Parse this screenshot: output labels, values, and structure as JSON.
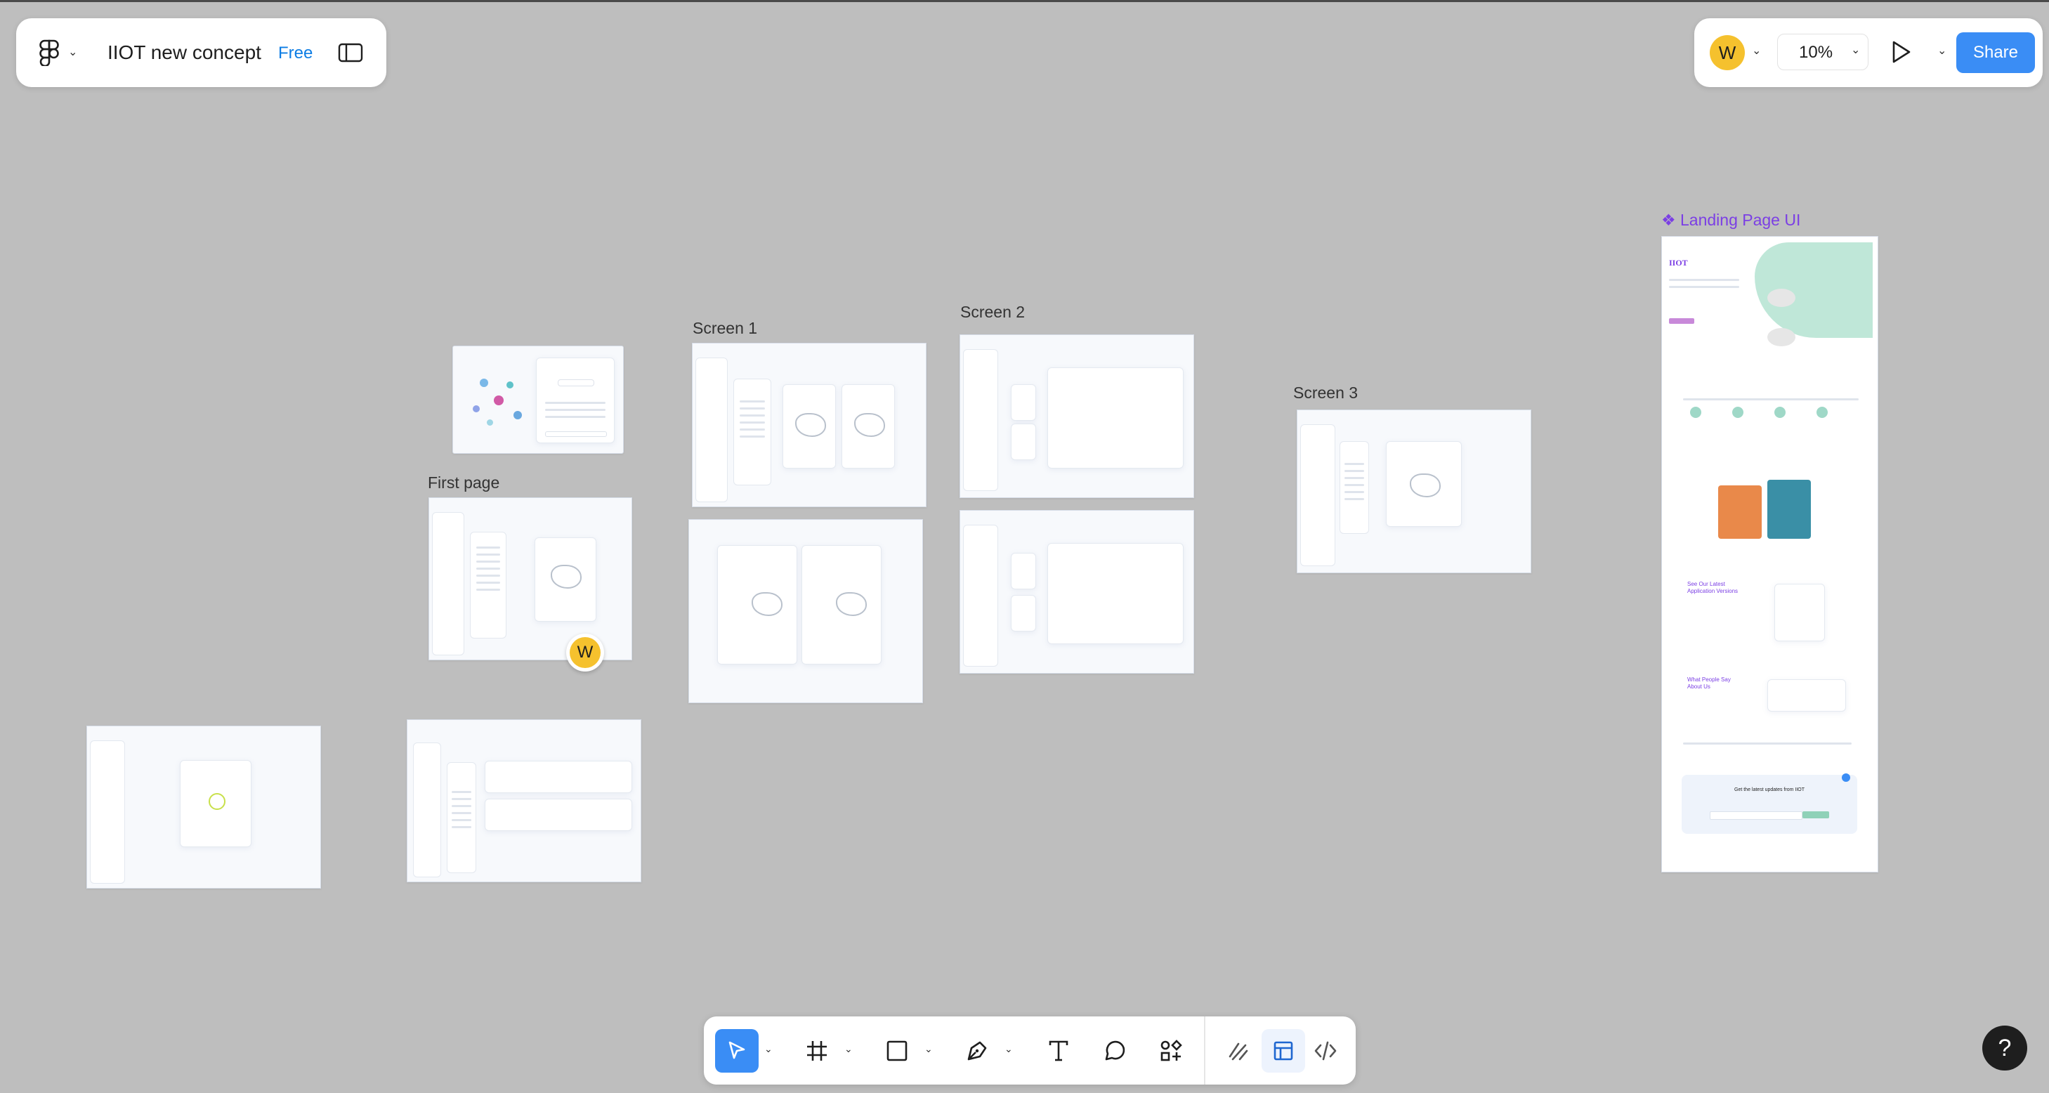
{
  "header": {
    "file_name": "IIOT new concept",
    "plan_badge": "Free"
  },
  "top_right": {
    "avatar_initial": "W",
    "zoom": "10%",
    "share_label": "Share"
  },
  "canvas": {
    "frame_labels": {
      "first_page": "First page",
      "screen1": "Screen 1",
      "screen2": "Screen 2",
      "screen3": "Screen 3",
      "landing": "❖ Landing Page UI"
    },
    "landing_page": {
      "logo": "IIOT",
      "section_title": "See Our Latest Application Versions",
      "testimonials_title": "What People Say About Us",
      "newsletter_title": "Get the latest updates from IIOT"
    },
    "collaborator_initial": "W"
  },
  "toolbar": {
    "tools": [
      "move-tool",
      "frame-tool",
      "shape-tool",
      "pen-tool",
      "text-tool",
      "comment-tool",
      "actions-tool",
      "draw-mode",
      "design-mode",
      "dev-mode"
    ]
  },
  "help": {
    "label": "?"
  },
  "colors": {
    "canvas_bg": "#bebebe",
    "accent_blue": "#0d99ff",
    "share_blue": "#3a8df5",
    "avatar_yellow": "#f5c12e",
    "landing_purple": "#7b3fe4"
  }
}
